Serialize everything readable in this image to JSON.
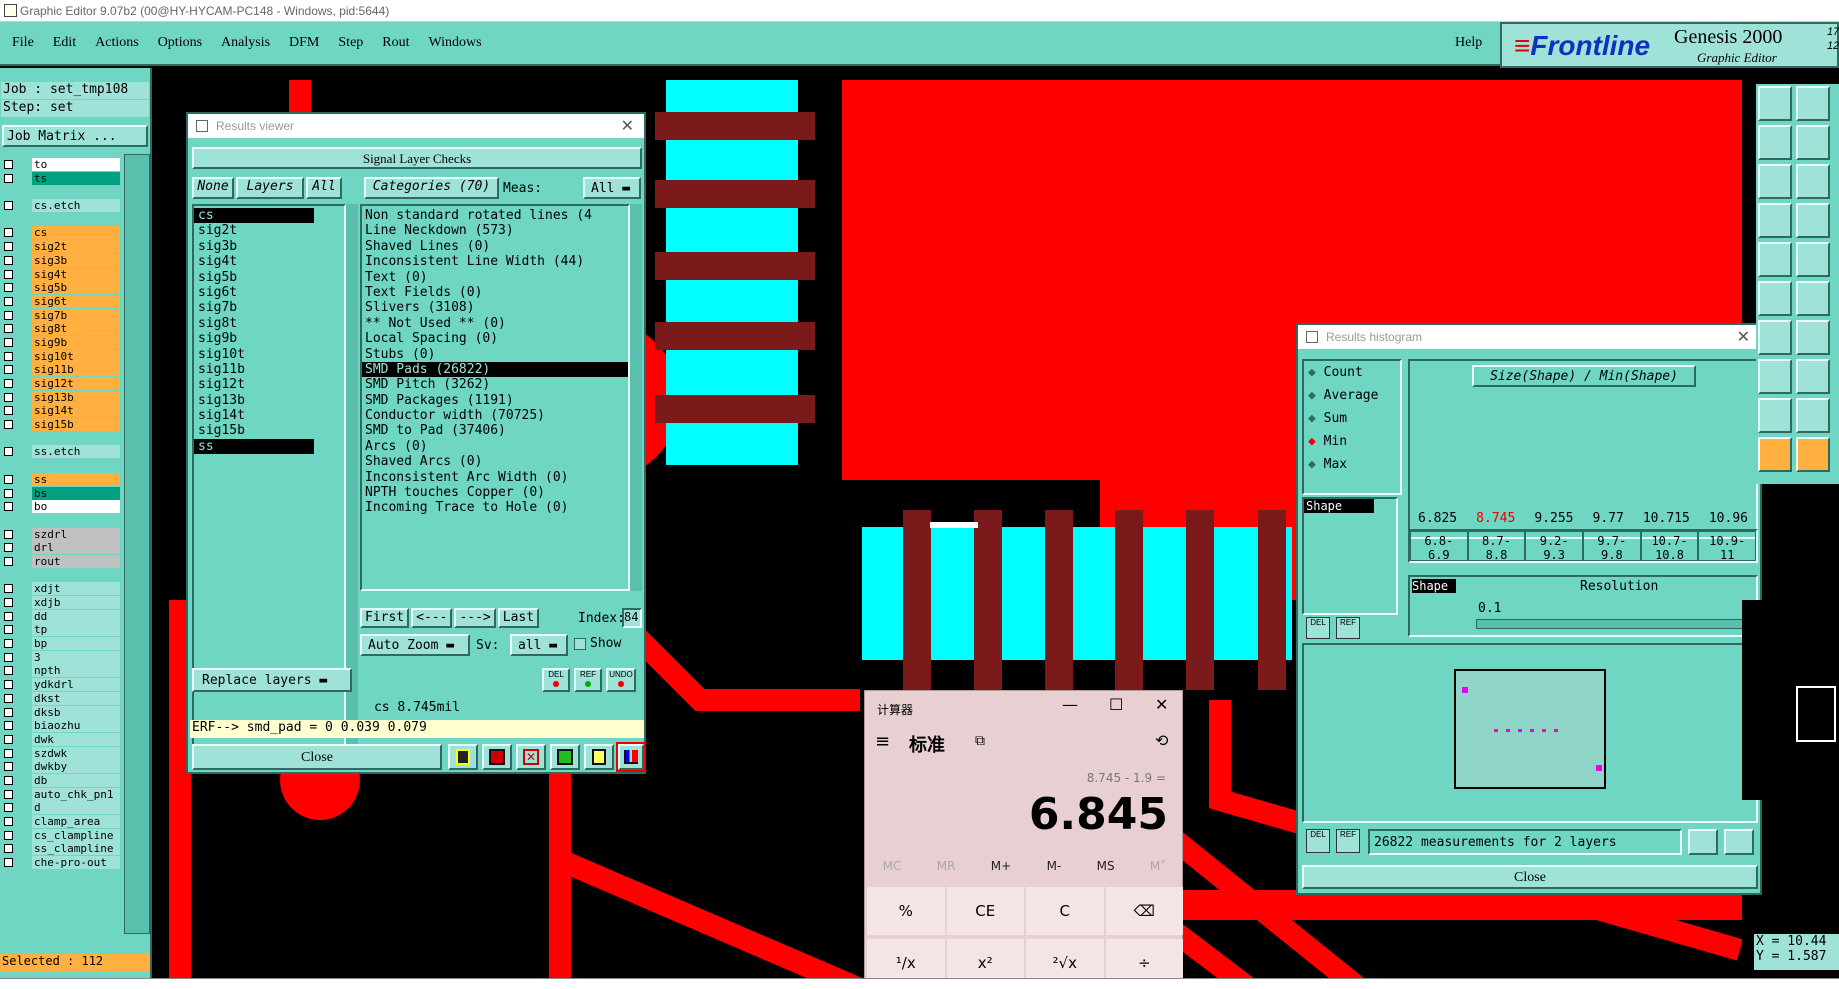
{
  "window_title": "Graphic Editor 9.07b2 (00@HY-HYCAM-PC148 - Windows, pid:5644)",
  "menu": [
    "File",
    "Edit",
    "Actions",
    "Options",
    "Analysis",
    "DFM",
    "Step",
    "Rout",
    "Windows"
  ],
  "help": "Help",
  "brand": {
    "logo": "Frontline",
    "product": "Genesis 2000",
    "subtitle": "Graphic Editor",
    "v1": "17",
    "v2": "12"
  },
  "left": {
    "job": "Job : set_tmp108",
    "step": "Step: set",
    "matrix": "Job Matrix ...",
    "selected": "Selected : 112",
    "layers": [
      {
        "n": "to",
        "c": "#ffffff"
      },
      {
        "n": "ts",
        "c": "#00a080"
      },
      {
        "n": "",
        "c": ""
      },
      {
        "n": "cs.etch",
        "c": "#9ee2d8"
      },
      {
        "n": "",
        "c": ""
      },
      {
        "n": "cs",
        "c": "#ffb040"
      },
      {
        "n": "sig2t",
        "c": "#ffb040"
      },
      {
        "n": "sig3b",
        "c": "#ffb040"
      },
      {
        "n": "sig4t",
        "c": "#ffb040"
      },
      {
        "n": "sig5b",
        "c": "#ffb040"
      },
      {
        "n": "sig6t",
        "c": "#ffb040"
      },
      {
        "n": "sig7b",
        "c": "#ffb040"
      },
      {
        "n": "sig8t",
        "c": "#ffb040"
      },
      {
        "n": "sig9b",
        "c": "#ffb040"
      },
      {
        "n": "sig10t",
        "c": "#ffb040"
      },
      {
        "n": "sig11b",
        "c": "#ffb040"
      },
      {
        "n": "sig12t",
        "c": "#ffb040"
      },
      {
        "n": "sig13b",
        "c": "#ffb040"
      },
      {
        "n": "sig14t",
        "c": "#ffb040"
      },
      {
        "n": "sig15b",
        "c": "#ffb040"
      },
      {
        "n": "",
        "c": ""
      },
      {
        "n": "ss.etch",
        "c": "#9ee2d8"
      },
      {
        "n": "",
        "c": ""
      },
      {
        "n": "ss",
        "c": "#ffb040"
      },
      {
        "n": "bs",
        "c": "#00a080"
      },
      {
        "n": "bo",
        "c": "#ffffff"
      },
      {
        "n": "",
        "c": ""
      },
      {
        "n": "szdrl",
        "c": "#c0c0c0"
      },
      {
        "n": "drl",
        "c": "#c0c0c0"
      },
      {
        "n": "rout",
        "c": "#c0c0c0"
      },
      {
        "n": "",
        "c": ""
      },
      {
        "n": "xdjt",
        "c": "#9ee2d8"
      },
      {
        "n": "xdjb",
        "c": "#9ee2d8"
      },
      {
        "n": "dd",
        "c": "#9ee2d8"
      },
      {
        "n": "tp",
        "c": "#9ee2d8"
      },
      {
        "n": "bp",
        "c": "#9ee2d8"
      },
      {
        "n": "3",
        "c": "#9ee2d8"
      },
      {
        "n": "npth",
        "c": "#9ee2d8"
      },
      {
        "n": "ydkdrl",
        "c": "#9ee2d8"
      },
      {
        "n": "dkst",
        "c": "#9ee2d8"
      },
      {
        "n": "dksb",
        "c": "#9ee2d8"
      },
      {
        "n": "biaozhu",
        "c": "#9ee2d8"
      },
      {
        "n": "dwk",
        "c": "#9ee2d8"
      },
      {
        "n": "szdwk",
        "c": "#9ee2d8"
      },
      {
        "n": "dwkby",
        "c": "#9ee2d8"
      },
      {
        "n": "db",
        "c": "#9ee2d8"
      },
      {
        "n": "auto_chk_pn1",
        "c": "#9ee2d8"
      },
      {
        "n": "d",
        "c": "#9ee2d8"
      },
      {
        "n": "clamp_area",
        "c": "#9ee2d8"
      },
      {
        "n": "cs_clampline",
        "c": "#9ee2d8"
      },
      {
        "n": "ss_clampline",
        "c": "#9ee2d8"
      },
      {
        "n": "che-pro-out",
        "c": "#9ee2d8"
      }
    ]
  },
  "results": {
    "title": "Results viewer",
    "section": "Signal Layer Checks",
    "none": "None",
    "layers_btn": "Layers",
    "all": "All",
    "categories": "Categories (70)",
    "meas": "Meas:",
    "meas_val": "All",
    "layers": [
      "cs",
      "sig2t",
      "sig3b",
      "sig4t",
      "sig5b",
      "sig6t",
      "sig7b",
      "sig8t",
      "sig9b",
      "sig10t",
      "sig11b",
      "sig12t",
      "sig13b",
      "sig14t",
      "sig15b",
      "ss"
    ],
    "checks": [
      "Non standard rotated lines (4",
      "Line Neckdown (573)",
      "Shaved Lines (0)",
      "Inconsistent Line Width (44)",
      "Text (0)",
      "Text Fields (0)",
      "Slivers (3108)",
      "** Not Used ** (0)",
      "Local Spacing (0)",
      "Stubs (0)",
      "SMD Pads (26822)",
      "SMD Pitch (3262)",
      "SMD Packages (1191)",
      "Conductor width (70725)",
      "SMD to Pad (37406)",
      "Arcs (0)",
      "Shaved Arcs (0)",
      "Inconsistent Arc Width (0)",
      "NPTH touches Copper (0)",
      "Incoming Trace to Hole (0)"
    ],
    "nav": [
      "First",
      "<---",
      "--->",
      "Last"
    ],
    "index": "Index:",
    "index_val": "84",
    "auto_zoom": "Auto Zoom",
    "sv": "Sv:",
    "sv_val": "all",
    "show": "Show",
    "replace": "Replace layers",
    "status": "cs 8.745mil",
    "erf": "ERF--> smd_pad = 0 0.039 0.079",
    "close": "Close",
    "mini": [
      "DEL",
      "REF",
      "UNDO"
    ]
  },
  "histogram": {
    "title": "Results histogram",
    "options": [
      "Count",
      "Average",
      "Sum",
      "Min",
      "Max"
    ],
    "selected": "Min",
    "formula": "Size(Shape) / Min(Shape)",
    "shape": "Shape",
    "resolution_label": "Resolution",
    "resolution_val": "0.1",
    "values": [
      "6.825",
      "8.745",
      "9.255",
      "9.77",
      "10.715",
      "10.96"
    ],
    "ranges": [
      "6.8- 6.9",
      "8.7- 8.8",
      "9.2- 9.3",
      "9.7- 9.8",
      "10.7- 10.8",
      "10.9- 11"
    ],
    "measurements": "26822 measurements for 2 layers",
    "close": "Close"
  },
  "calc": {
    "title": "计算器",
    "mode": "标准",
    "expr": "8.745 - 1.9 =",
    "display": "6.845",
    "mem": [
      "MC",
      "MR",
      "M+",
      "M-",
      "MS",
      "M˅"
    ],
    "row1": [
      "%",
      "CE",
      "C",
      "⌫"
    ],
    "row2": [
      "¹/x",
      "x²",
      "²√x",
      "÷"
    ]
  },
  "coords": {
    "x": "X = 10.44",
    "y": "Y = 1.587"
  },
  "colors": {
    "teal": "#6fd6c4",
    "board_red": "#ff0000",
    "cyan": "#00ffff",
    "maroon": "#7a1a1a"
  }
}
